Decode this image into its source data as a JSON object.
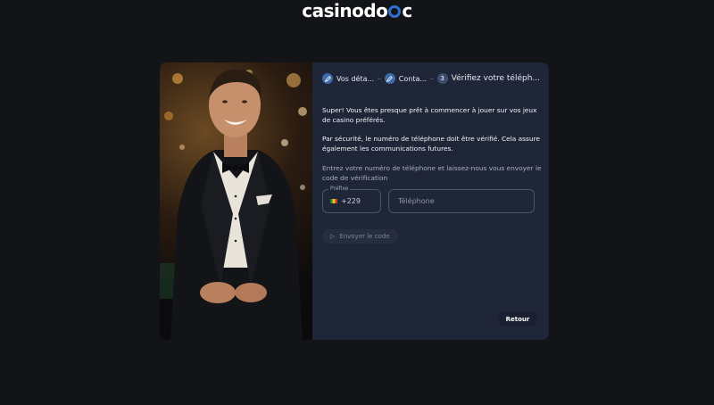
{
  "brand": {
    "logo_left": "casino",
    "logo_right": "c"
  },
  "stepper": {
    "steps": [
      {
        "label": "Vos déta...",
        "icon": "pencil-icon"
      },
      {
        "label": "Conta...",
        "icon": "pencil-icon"
      },
      {
        "number": "3",
        "label": "Vérifiez votre téléph..."
      }
    ]
  },
  "intro": {
    "paragraph1": "Super! Vous êtes presque prêt à commencer à jouer sur vos jeux de casino préférés.",
    "paragraph2": "Par sécurité, le numéro de téléphone doit être vérifié. Cela assure également les communications futures."
  },
  "form": {
    "instruction": "Entrez votre numéro de téléphone et laissez-nous vous envoyer le code de vérification",
    "prefix_label": "Préfixe",
    "prefix_value": "+229",
    "phone_placeholder": "Téléphone",
    "send_label": "Envoyer le code"
  },
  "footer": {
    "back_label": "Retour"
  },
  "colors": {
    "accent": "#3d6aa8",
    "background": "#121418",
    "panel": "#1f2638"
  }
}
